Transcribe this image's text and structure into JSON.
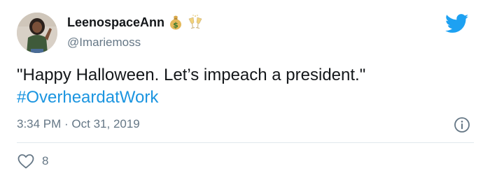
{
  "tweet": {
    "author": {
      "display_name": "LeenospaceAnn",
      "handle": "@Imariemoss",
      "name_emojis": [
        "money-bag-emoji",
        "clinking-glasses-emoji"
      ]
    },
    "text": {
      "line1": "\"Happy Halloween. Let’s impeach a president.\"",
      "hashtag": "#OverheardatWork"
    },
    "timestamp": "3:34 PM · Oct 31, 2019",
    "likes": {
      "count": "8",
      "icon": "heart-outline-icon"
    },
    "icons": {
      "logo": "twitter-bird-icon",
      "info": "info-icon"
    },
    "colors": {
      "hashtag": "#1b95e0",
      "twitter_blue": "#1da1f2",
      "secondary_text": "#657786"
    }
  }
}
